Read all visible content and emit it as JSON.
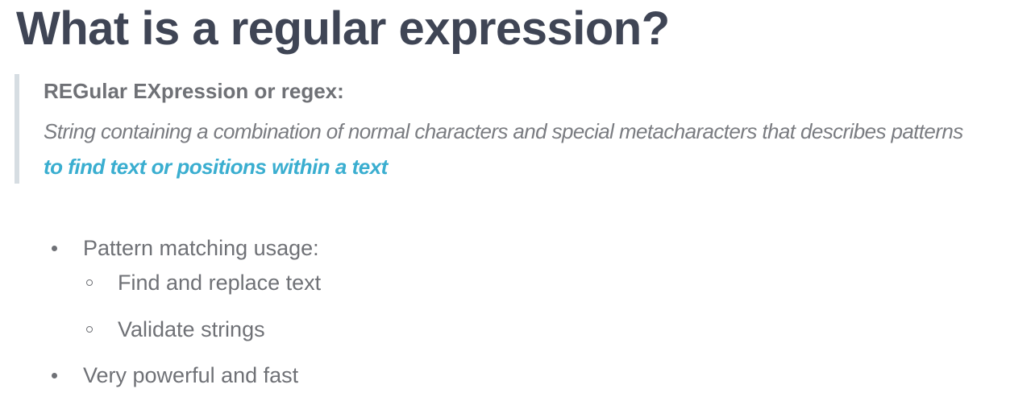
{
  "title": "What is a regular expression?",
  "definition": {
    "heading": "REGular EXpression or regex:",
    "text": "String containing a combination of normal characters and special metacharacters that describes patterns",
    "emphasis": "to find text or positions within a text"
  },
  "list": {
    "item1": "Pattern matching usage:",
    "sub1": "Find and replace text",
    "sub2": "Validate strings",
    "item2": "Very powerful and fast"
  },
  "colors": {
    "title": "#3f4555",
    "body_text": "#6f7176",
    "accent": "#3aaed0",
    "quote_border": "#d6dde2"
  }
}
